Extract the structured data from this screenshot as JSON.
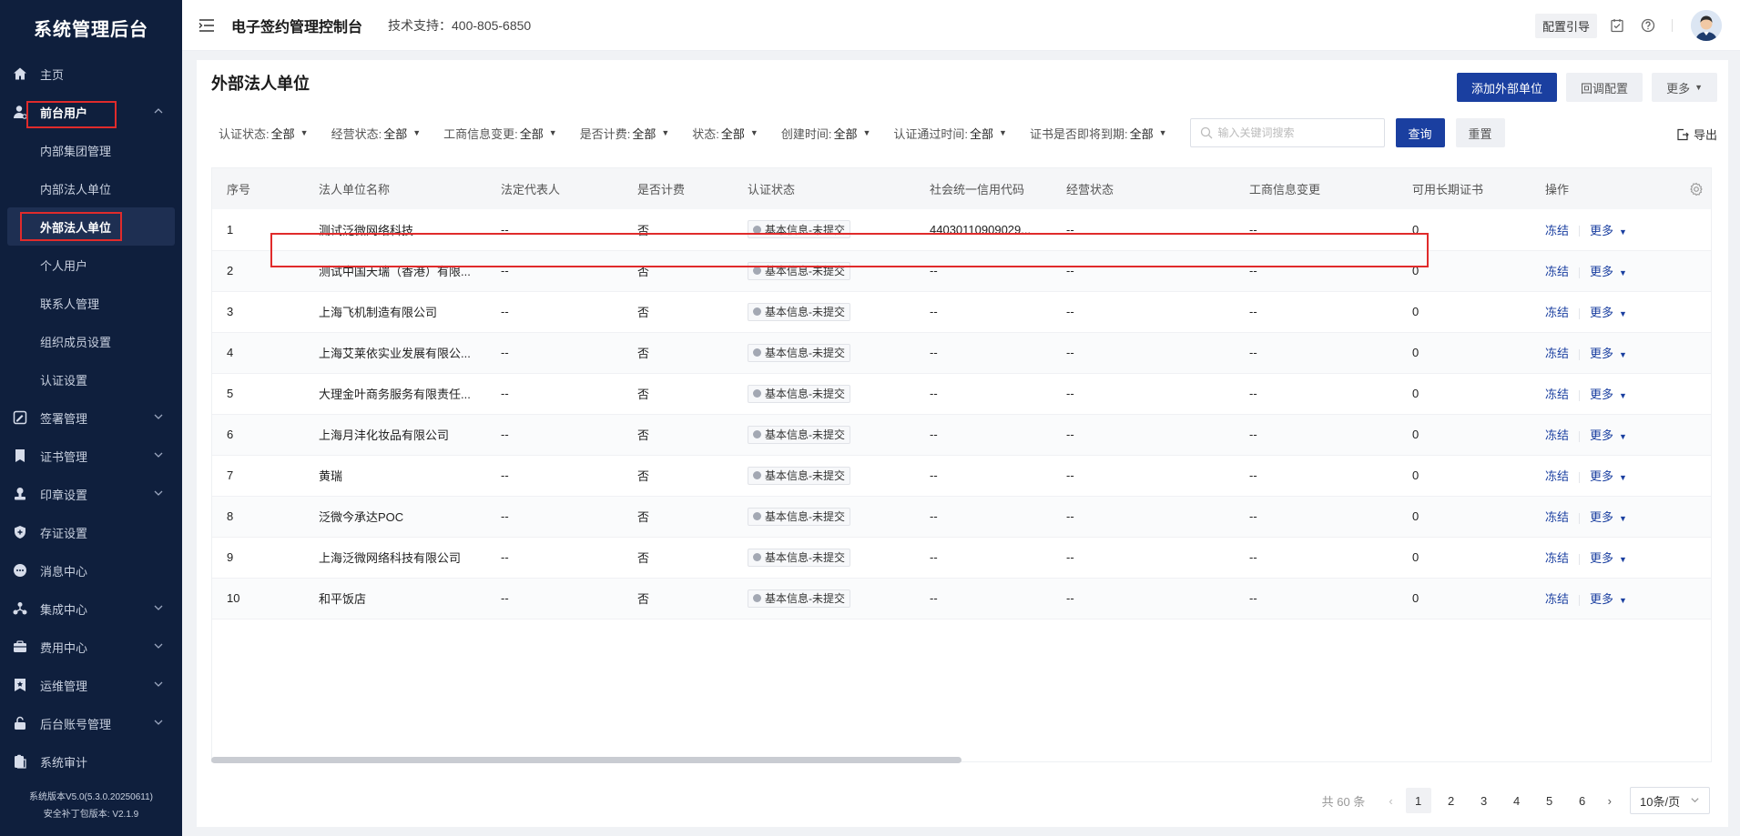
{
  "sidebar": {
    "brand": "系统管理后台",
    "items": [
      {
        "label": "主页",
        "icon": "home-icon"
      },
      {
        "label": "前台用户",
        "icon": "user-icon"
      },
      {
        "label": "签署管理",
        "icon": "sign-icon"
      },
      {
        "label": "证书管理",
        "icon": "certificate-icon"
      },
      {
        "label": "印章设置",
        "icon": "seal-icon"
      },
      {
        "label": "存证设置",
        "icon": "shield-icon"
      },
      {
        "label": "消息中心",
        "icon": "message-icon"
      },
      {
        "label": "集成中心",
        "icon": "integration-icon"
      },
      {
        "label": "费用中心",
        "icon": "wallet-icon"
      },
      {
        "label": "运维管理",
        "icon": "bookmark-icon"
      },
      {
        "label": "后台账号管理",
        "icon": "lock-icon"
      },
      {
        "label": "系统审计",
        "icon": "audit-icon"
      }
    ],
    "sub_items": [
      "内部集团管理",
      "内部法人单位",
      "外部法人单位",
      "个人用户",
      "联系人管理",
      "组织成员设置",
      "认证设置"
    ],
    "version": "系统版本V5.0(5.3.0.20250611)",
    "patch": "安全补丁包版本: V2.1.9"
  },
  "topbar": {
    "title": "电子签约管理控制台",
    "support": "技术支持：400-805-6850",
    "guide": "配置引导"
  },
  "page": {
    "title": "外部法人单位",
    "add_button": "添加外部单位",
    "callback_button": "回调配置",
    "more_button": "更多"
  },
  "filters": [
    {
      "label": "认证状态:",
      "value": "全部"
    },
    {
      "label": "经营状态:",
      "value": "全部"
    },
    {
      "label": "工商信息变更:",
      "value": "全部"
    },
    {
      "label": "是否计费:",
      "value": "全部"
    },
    {
      "label": "状态:",
      "value": "全部"
    },
    {
      "label": "创建时间:",
      "value": "全部"
    },
    {
      "label": "认证通过时间:",
      "value": "全部"
    },
    {
      "label": "证书是否即将到期:",
      "value": "全部"
    }
  ],
  "search": {
    "placeholder": "输入关键词搜索",
    "query_button": "查询",
    "reset_button": "重置"
  },
  "export_label": "导出",
  "table": {
    "headers": [
      "序号",
      "法人单位名称",
      "法定代表人",
      "是否计费",
      "认证状态",
      "社会统一信用代码",
      "经营状态",
      "工商信息变更",
      "可用长期证书",
      "操作"
    ],
    "rows": [
      [
        "1",
        "测试泛微网络科技",
        "--",
        "否",
        "基本信息-未提交",
        "44030110909029...",
        "--",
        "--",
        "0"
      ],
      [
        "2",
        "测试中国天瑞（香港）有限...",
        "--",
        "否",
        "基本信息-未提交",
        "--",
        "--",
        "--",
        "0"
      ],
      [
        "3",
        "上海飞机制造有限公司",
        "--",
        "否",
        "基本信息-未提交",
        "--",
        "--",
        "--",
        "0"
      ],
      [
        "4",
        "上海艾莱依实业发展有限公...",
        "--",
        "否",
        "基本信息-未提交",
        "--",
        "--",
        "--",
        "0"
      ],
      [
        "5",
        "大理金叶商务服务有限责任...",
        "--",
        "否",
        "基本信息-未提交",
        "--",
        "--",
        "--",
        "0"
      ],
      [
        "6",
        "上海月沣化妆品有限公司",
        "--",
        "否",
        "基本信息-未提交",
        "--",
        "--",
        "--",
        "0"
      ],
      [
        "7",
        "黄瑞",
        "--",
        "否",
        "基本信息-未提交",
        "--",
        "--",
        "--",
        "0"
      ],
      [
        "8",
        "泛微今承达POC",
        "--",
        "否",
        "基本信息-未提交",
        "--",
        "--",
        "--",
        "0"
      ],
      [
        "9",
        "上海泛微网络科技有限公司",
        "--",
        "否",
        "基本信息-未提交",
        "--",
        "--",
        "--",
        "0"
      ],
      [
        "10",
        "和平饭店",
        "--",
        "否",
        "基本信息-未提交",
        "--",
        "--",
        "--",
        "0"
      ]
    ],
    "op_freeze": "冻结",
    "op_more": "更多"
  },
  "pagination": {
    "total": "共 60 条",
    "pages": [
      "1",
      "2",
      "3",
      "4",
      "5",
      "6"
    ],
    "current": "1",
    "page_size": "10条/页"
  },
  "colors": {
    "sidebar_bg": "#0f1f3d",
    "primary": "#1a3fa0",
    "highlight": "#e02b2b"
  }
}
